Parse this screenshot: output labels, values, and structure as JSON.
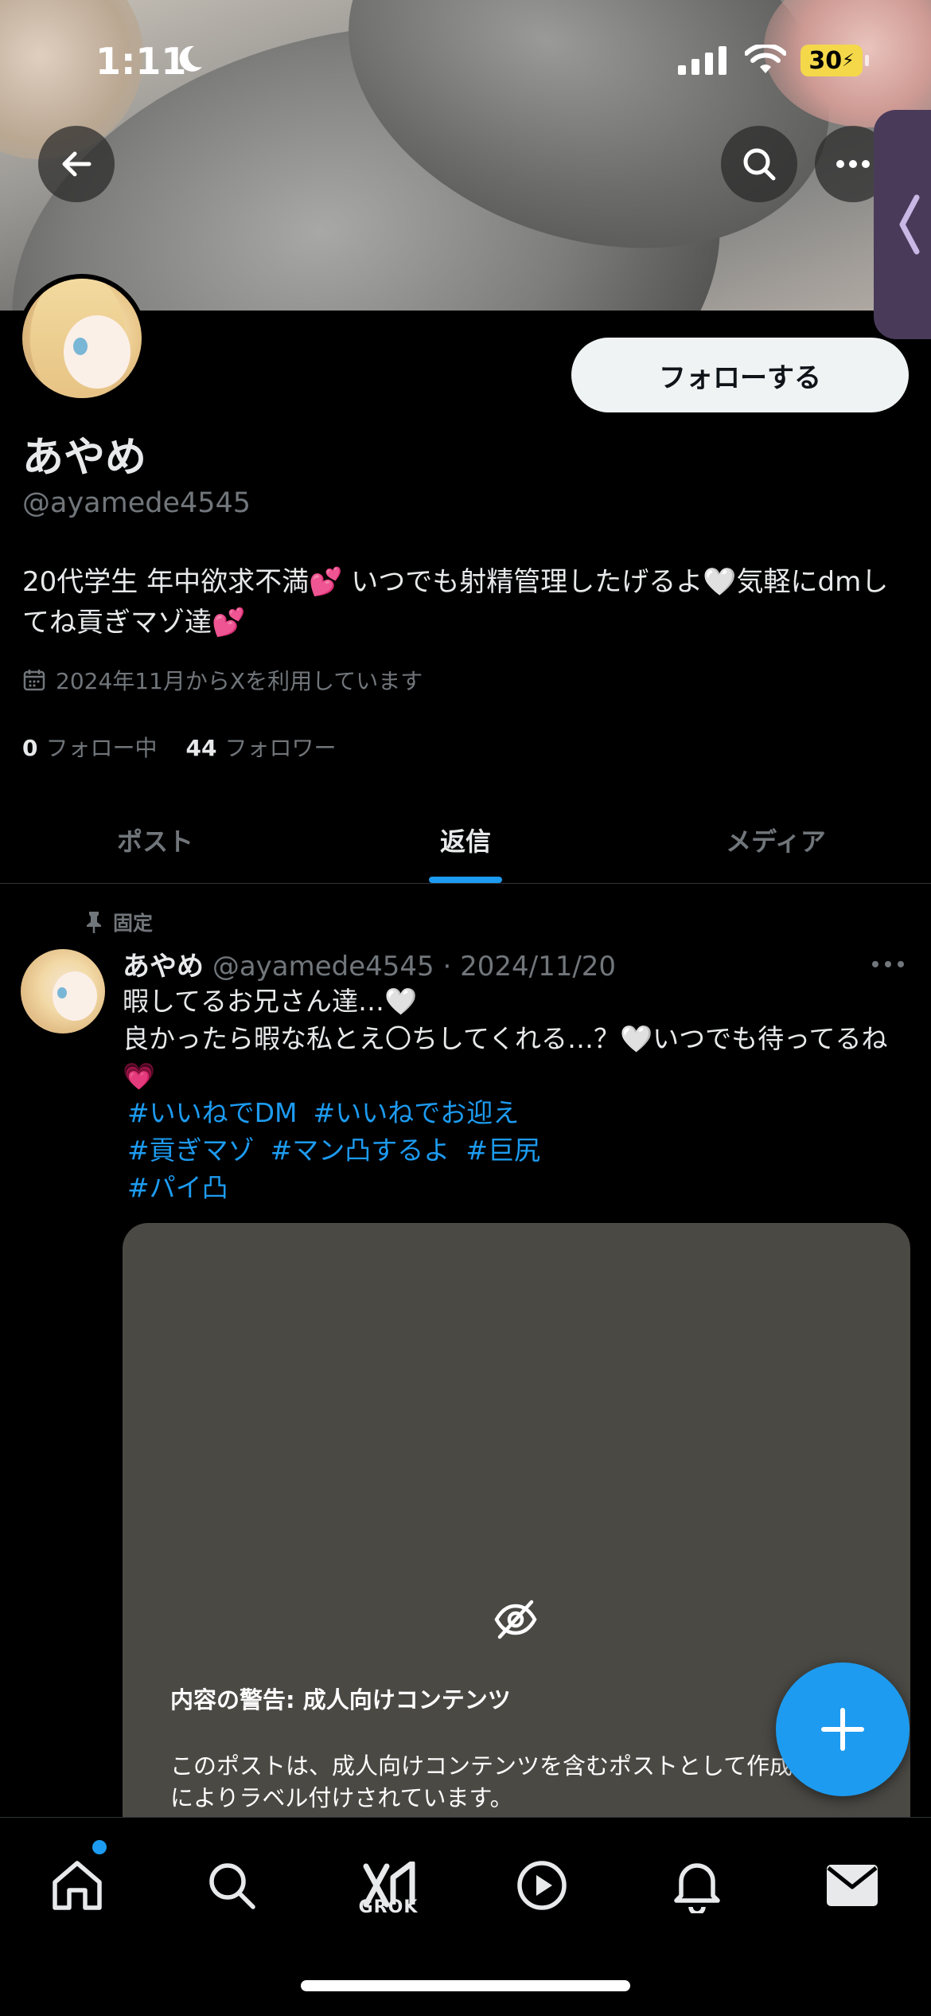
{
  "status": {
    "time": "1:11",
    "battery": "30"
  },
  "profile": {
    "follow_label": "フォローする",
    "display_name": "あやめ",
    "handle": "@ayamede4545",
    "bio": "20代学生 年中欲求不満💕 いつでも射精管理したげるよ🤍気軽にdmしてね貢ぎマゾ達💕",
    "joined": "2024年11月からXを利用しています",
    "following_count": "0",
    "following_label": "フォロー中",
    "followers_count": "44",
    "followers_label": "フォロワー"
  },
  "tabs": [
    {
      "label": "ポスト",
      "active": false
    },
    {
      "label": "返信",
      "active": true
    },
    {
      "label": "メディア",
      "active": false
    }
  ],
  "post": {
    "pinned_label": "固定",
    "author": "あやめ",
    "handle_date": "@ayamede4545 · 2024/11/20",
    "text_line1": "暇してるお兄さん達…🤍",
    "text_line2": "良かったら暇な私とえ〇ちしてくれる…？🤍いつでも待ってるね💗",
    "hashtags": [
      "#いいねでDM",
      "#いいねでお迎え",
      "#貢ぎマゾ",
      "#マン凸するよ",
      "#巨尻",
      "#パイ凸"
    ],
    "warning_title": "内容の警告: 成人向けコンテンツ",
    "warning_text": "このポストは、成人向けコンテンツを含むポストとして作成者によりラベル付けされています。"
  },
  "nav": {
    "grok_label": "GROK"
  },
  "colors": {
    "accent": "#1d9bf0",
    "muted": "#71767b",
    "text": "#e7e9ea"
  }
}
